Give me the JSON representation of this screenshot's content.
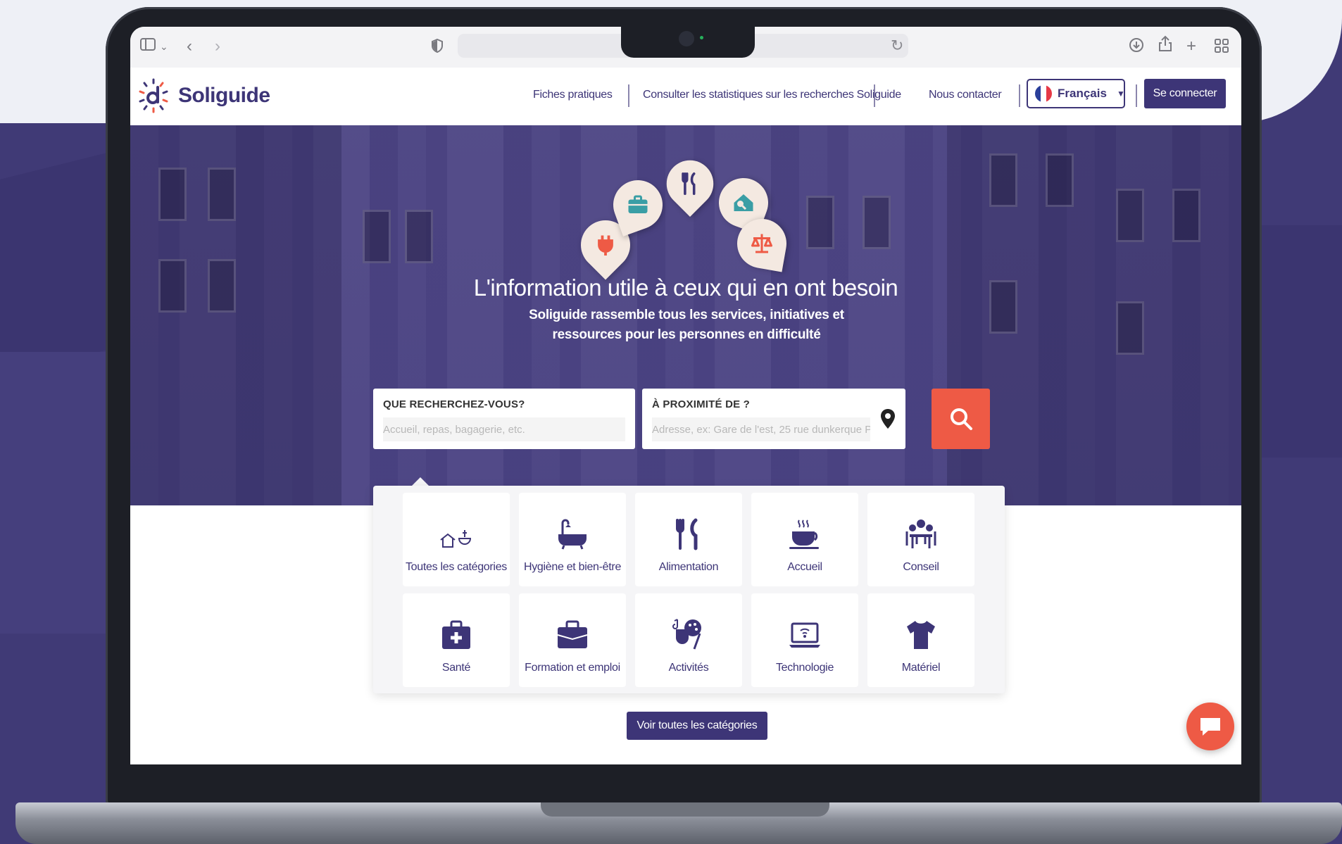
{
  "colors": {
    "brand": "#3d3577",
    "accent": "#ee5a45",
    "backdrop": "#403a76",
    "pin_background": "#f4e9e1",
    "pin_teal": "#3a9ea5",
    "pin_coral": "#ee5a45"
  },
  "browser": {
    "icons": [
      "sidebar-icon",
      "chevron-down-icon",
      "back-icon",
      "forward-icon",
      "shield-icon",
      "reload-icon",
      "download-icon",
      "share-icon",
      "new-tab-icon",
      "tab-overview-icon"
    ]
  },
  "header": {
    "logo_text": "Soliguide",
    "nav": [
      {
        "label": "Fiches pratiques"
      },
      {
        "label": "Consulter les statistiques sur les recherches Soliguide"
      },
      {
        "label": "Nous contacter"
      }
    ],
    "language": {
      "label": "Français"
    },
    "login_label": "Se connecter"
  },
  "hero": {
    "title": "L'information utile à ceux qui en ont besoin",
    "subtitle": "Soliguide rassemble tous les services, initiatives et ressources pour les personnes en difficulté",
    "pins": [
      "plug-icon",
      "briefcase-icon",
      "fork-knife-icon",
      "house-search-icon",
      "scale-icon"
    ]
  },
  "search": {
    "what_label": "QUE RECHERCHEZ-VOUS?",
    "what_placeholder": "Accueil, repas, bagagerie, etc.",
    "where_label": "À PROXIMITÉ DE ?",
    "where_placeholder": "Adresse, ex: Gare de l'est, 25 rue dunkerque P"
  },
  "categories": [
    {
      "label": "Toutes les catégories",
      "icon": "all-categories-icon"
    },
    {
      "label": "Hygiène et bien-être",
      "icon": "bathtub-icon"
    },
    {
      "label": "Alimentation",
      "icon": "fork-knife-icon"
    },
    {
      "label": "Accueil",
      "icon": "coffee-cup-icon"
    },
    {
      "label": "Conseil",
      "icon": "advice-icon"
    },
    {
      "label": "Santé",
      "icon": "medical-kit-icon"
    },
    {
      "label": "Formation et emploi",
      "icon": "briefcase-icon"
    },
    {
      "label": "Activités",
      "icon": "theater-palette-icon"
    },
    {
      "label": "Technologie",
      "icon": "laptop-wifi-icon"
    },
    {
      "label": "Matériel",
      "icon": "tshirt-icon"
    }
  ],
  "all_categories_button": "Voir toutes les catégories"
}
